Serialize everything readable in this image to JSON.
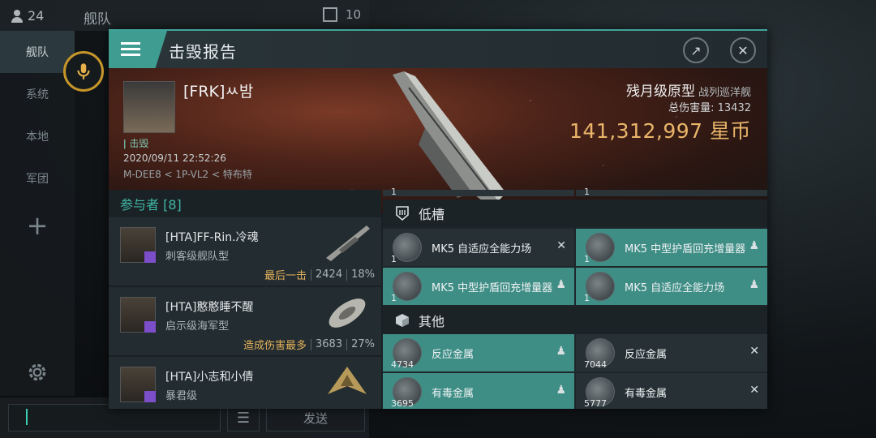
{
  "background": {
    "online_count": "24",
    "section_title": "舰队",
    "member_count": "10",
    "nav_items": [
      "舰队",
      "系统",
      "本地",
      "军团"
    ],
    "send_label": "发送"
  },
  "modal": {
    "title": "击毁报告",
    "victim": {
      "name": "[FRK]ㅆ밤",
      "status": "击毁",
      "datetime": "2020/09/11 22:52:26",
      "location": "M-DEE8 < 1P-VL2 < 特布特"
    },
    "ship": {
      "name": "残月级原型",
      "class": "战列巡洋舰",
      "total_damage_label": "总伤害量:",
      "total_damage": "13432",
      "isk_value": "141,312,997",
      "isk_unit": "星币"
    },
    "participants": {
      "header": "参与者 [8]",
      "rows": [
        {
          "name": "[HTA]FF-Rin.冷魂",
          "ship": "刺客级舰队型",
          "tag": "最后一击",
          "damage": "2424",
          "percent": "18%"
        },
        {
          "name": "[HTA]憨憨睡不醒",
          "ship": "启示级海军型",
          "tag": "造成伤害最多",
          "damage": "3683",
          "percent": "27%"
        },
        {
          "name": "[HTA]小志和小倩",
          "ship": "暴君级",
          "tag": "",
          "damage": "",
          "percent": ""
        }
      ]
    },
    "items": {
      "top_qty_left": "1",
      "top_qty_right": "1",
      "low_slot_title": "低槽",
      "other_title": "其他",
      "low_slot": [
        {
          "label": "MK5 自适应全能力场",
          "qty": "1",
          "state": "destroyed",
          "mark": "✕"
        },
        {
          "label": "MK5 中型护盾回充增量器",
          "qty": "1",
          "state": "dropped",
          "mark": "♟"
        },
        {
          "label": "MK5 中型护盾回充增量器",
          "qty": "1",
          "state": "dropped",
          "mark": "♟"
        },
        {
          "label": "MK5 自适应全能力场",
          "qty": "1",
          "state": "dropped",
          "mark": "♟"
        }
      ],
      "other": [
        {
          "label": "反应金属",
          "qty": "4734",
          "state": "dropped",
          "mark": "♟"
        },
        {
          "label": "反应金属",
          "qty": "7044",
          "state": "destroyed",
          "mark": "✕"
        },
        {
          "label": "有毒金属",
          "qty": "3695",
          "state": "dropped",
          "mark": "♟"
        },
        {
          "label": "有毒金属",
          "qty": "5777",
          "state": "destroyed",
          "mark": "✕"
        }
      ]
    }
  },
  "colors": {
    "accent": "#3f9c91",
    "isk": "#e8b56a",
    "dropped": "#3f8e86",
    "destroyed": "#273135"
  }
}
